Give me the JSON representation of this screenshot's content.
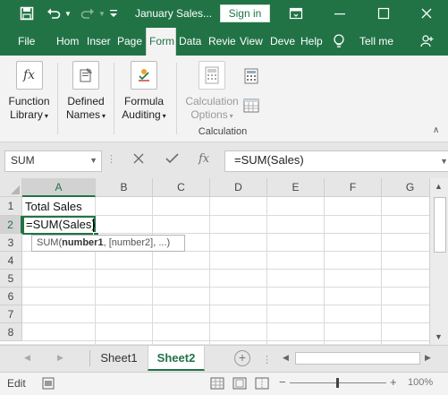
{
  "titlebar": {
    "title": "January Sales...",
    "signin_label": "Sign in",
    "colors": {
      "brand": "#217346"
    }
  },
  "tabs": [
    {
      "label": "File"
    },
    {
      "label": "Hom"
    },
    {
      "label": "Inser"
    },
    {
      "label": "Page"
    },
    {
      "label": "Form"
    },
    {
      "label": "Data"
    },
    {
      "label": "Revie"
    },
    {
      "label": "View"
    },
    {
      "label": "Deve"
    },
    {
      "label": "Help"
    },
    {
      "label": "Tell me"
    }
  ],
  "ribbon": {
    "function_library": {
      "line1": "Function",
      "line2": "Library"
    },
    "defined_names": {
      "line1": "Defined",
      "line2": "Names"
    },
    "formula_auditing": {
      "line1": "Formula",
      "line2": "Auditing"
    },
    "calculation_options": {
      "line1": "Calculation",
      "line2": "Options"
    },
    "group_calculation": "Calculation"
  },
  "formula_bar": {
    "name_box": "SUM",
    "fx_label": "fx",
    "formula": "=SUM(Sales)"
  },
  "grid": {
    "columns": [
      "A",
      "B",
      "C",
      "D",
      "E",
      "F",
      "G"
    ],
    "rows": [
      "1",
      "2",
      "3",
      "4",
      "5",
      "6",
      "7",
      "8"
    ],
    "cells": {
      "A1": "Total Sales",
      "A2": "=SUM(Sales)"
    },
    "tooltip": {
      "fn": "SUM(",
      "arg_bold": "number1",
      "rest": ", [number2], ...)"
    }
  },
  "sheets": {
    "tabs": [
      "Sheet1",
      "Sheet2"
    ],
    "active": "Sheet2"
  },
  "status": {
    "mode": "Edit",
    "zoom": "100%"
  }
}
